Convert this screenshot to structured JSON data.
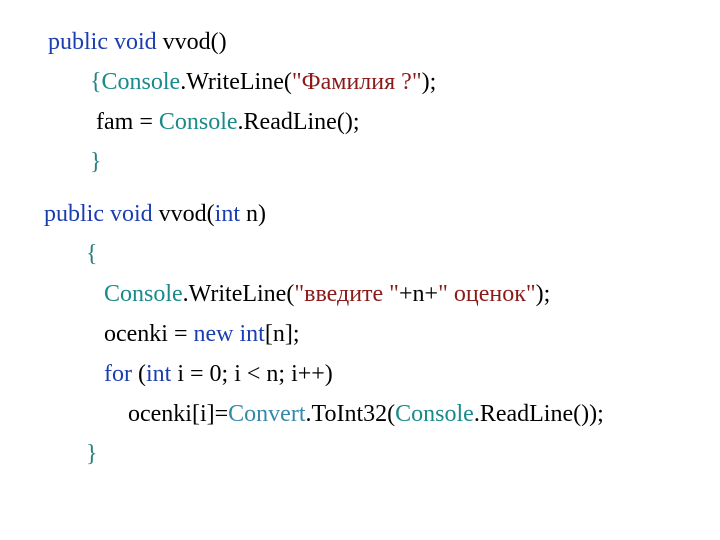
{
  "method1": {
    "sig": {
      "public": "public",
      "void": "void",
      "name": "vvod()"
    },
    "l1": {
      "brace": "{",
      "console": "Console",
      "dot": ".",
      "write": "WriteLine",
      "open": "(",
      "str": "\"Фамилия ?\"",
      "close": ");"
    },
    "l2": {
      "fam": " fam = ",
      "console": "Console",
      "dot": ".",
      "read": "ReadLine",
      "close": "();"
    },
    "l3": {
      "brace": "}"
    }
  },
  "method2": {
    "sig": {
      "public": "public",
      "void": "void",
      "name": "vvod(",
      "int": "int",
      "param": " n)"
    },
    "l1": {
      "brace": "{"
    },
    "l2": {
      "pad": "   ",
      "console": "Console",
      "dot": ".",
      "write": "WriteLine",
      "open": "(",
      "str1": "\"введите \"",
      "plus1": "+n+",
      "str2": "\" оценок\"",
      "close": ");"
    },
    "l3": {
      "pad": "   ",
      "ocenki": "ocenki = ",
      "new": "new",
      "sp": " ",
      "int": "int",
      "rest": "[n];"
    },
    "l4": {
      "pad": "   ",
      "for": "for",
      "open": " (",
      "int": "int",
      "rest": " i = 0; i < n; i++)"
    },
    "l5": {
      "pad": "       ",
      "lhs": "ocenki[i]=",
      "convert": "Convert",
      "dot1": ".",
      "toint": "ToInt32",
      "open": "(",
      "console": "Console",
      "dot2": ".",
      "read": "ReadLine",
      "close": "());"
    },
    "l6": {
      "brace": "}"
    }
  }
}
